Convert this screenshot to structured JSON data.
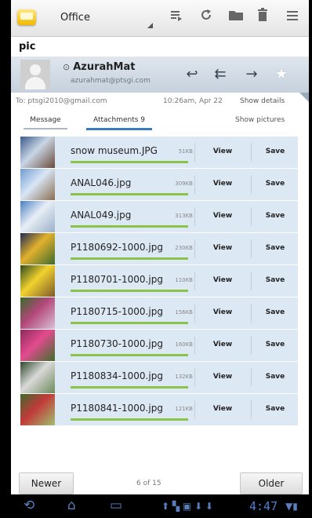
{
  "toolbar": {
    "folder": "Office",
    "icons": [
      "app-icon",
      "move-icon",
      "refresh-icon",
      "folder-icon",
      "delete-icon",
      "menu-icon"
    ]
  },
  "message": {
    "subject": "pic",
    "sender_name": "AzurahMat",
    "sender_email": "azurahmat@ptsgi.com",
    "to": "To: ptsgi2010@gmail.com",
    "time": "10:26am, Apr 22",
    "show_details": "Show details"
  },
  "tabs": {
    "message": "Message",
    "attachments": "Attachments 9",
    "show_pictures": "Show pictures"
  },
  "attachments": [
    {
      "name": "snow museum.JPG",
      "size": "51KB",
      "view": "View",
      "save": "Save",
      "progress": 1.0,
      "colors": [
        "#3b5a8a",
        "#c9d6e6",
        "#6a4a3a"
      ]
    },
    {
      "name": "ANAL046.jpg",
      "size": "309KB",
      "view": "View",
      "save": "Save",
      "progress": 1.0,
      "colors": [
        "#6f9bd0",
        "#d8e6f5",
        "#8a6d50"
      ]
    },
    {
      "name": "ANAL049.jpg",
      "size": "313KB",
      "view": "View",
      "save": "Save",
      "progress": 1.0,
      "colors": [
        "#4a7fc0",
        "#e8eef6",
        "#9ab0c8"
      ]
    },
    {
      "name": "P1180692-1000.jpg",
      "size": "230KB",
      "view": "View",
      "save": "Save",
      "progress": 1.0,
      "colors": [
        "#1d2a55",
        "#e2b12c",
        "#3d6b2e"
      ]
    },
    {
      "name": "P1180701-1000.jpg",
      "size": "110KB",
      "view": "View",
      "save": "Save",
      "progress": 1.0,
      "colors": [
        "#2e4a1e",
        "#f2d22e",
        "#7a5a2a"
      ]
    },
    {
      "name": "P1180715-1000.jpg",
      "size": "156KB",
      "view": "View",
      "save": "Save",
      "progress": 1.0,
      "colors": [
        "#3a6a2a",
        "#b3477a",
        "#d9c1d6"
      ]
    },
    {
      "name": "P1180730-1000.jpg",
      "size": "160KB",
      "view": "View",
      "save": "Save",
      "progress": 1.0,
      "colors": [
        "#8a2a5a",
        "#e24b8f",
        "#3f6e2a"
      ]
    },
    {
      "name": "P1180834-1000.jpg",
      "size": "132KB",
      "view": "View",
      "save": "Save",
      "progress": 1.0,
      "colors": [
        "#2e4a2a",
        "#d9d9d9",
        "#6d8a5a"
      ]
    },
    {
      "name": "P1180841-1000.jpg",
      "size": "121KB",
      "view": "View",
      "save": "Save",
      "progress": 1.0,
      "colors": [
        "#3e6a2e",
        "#c23a3a",
        "#a0c070"
      ]
    }
  ],
  "nav": {
    "newer": "Newer",
    "page": "6 of 15",
    "older": "Older"
  },
  "system": {
    "clock": "4:47",
    "icons": [
      "back-icon",
      "home-icon",
      "recent-apps-icon"
    ]
  }
}
